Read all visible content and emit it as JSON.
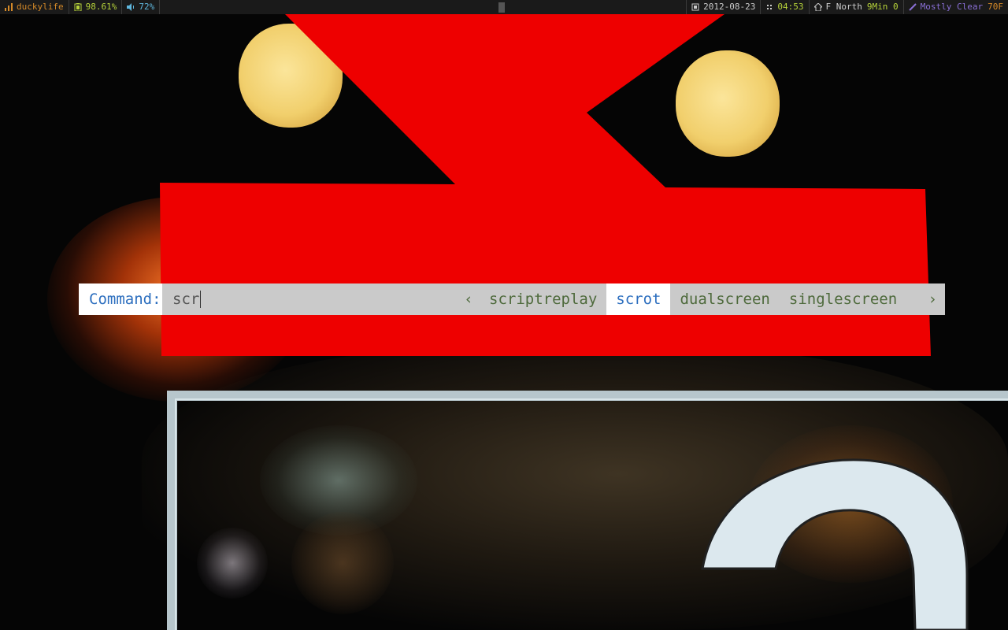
{
  "colors": {
    "statusbar_bg": "#1a1a1a",
    "hostname": "#d58a28",
    "battery": "#b6d23a",
    "volume": "#5fb7dd",
    "date": "#cccccc",
    "time": "#b6d23a",
    "weather_text": "#8a6fd6",
    "temperature": "#d58a28",
    "prompt_label": "#2d6fbf",
    "prompt_candidate": "#4e6a3c"
  },
  "statusbar": {
    "hostname": {
      "icon": "signal-bars-icon",
      "text": "duckylife"
    },
    "battery": {
      "icon": "battery-icon",
      "text": "98.61%"
    },
    "volume": {
      "icon": "speaker-icon",
      "text": "72%"
    },
    "date": {
      "icon": "calendar-icon",
      "text": "2012-08-23"
    },
    "time": {
      "icon": "clock-icon",
      "text": "04:53"
    },
    "wind": {
      "icon": "home-icon",
      "dir": "F North",
      "speed": "9Min 0"
    },
    "weather": {
      "icon": "pencil-icon",
      "text": "Mostly Clear",
      "temp": "70F"
    }
  },
  "prompt": {
    "label": "Command:",
    "input_value": "scr",
    "prev_arrow": "‹",
    "next_arrow": "›",
    "candidates": [
      "scriptreplay",
      "scrot",
      "dualscreen",
      "singlescreen"
    ],
    "selected_index": 1
  },
  "wallpaper": {
    "description_icons": [
      "red-letter-shape",
      "bokeh-lights",
      "sign-frame",
      "white-letter-shape"
    ]
  }
}
